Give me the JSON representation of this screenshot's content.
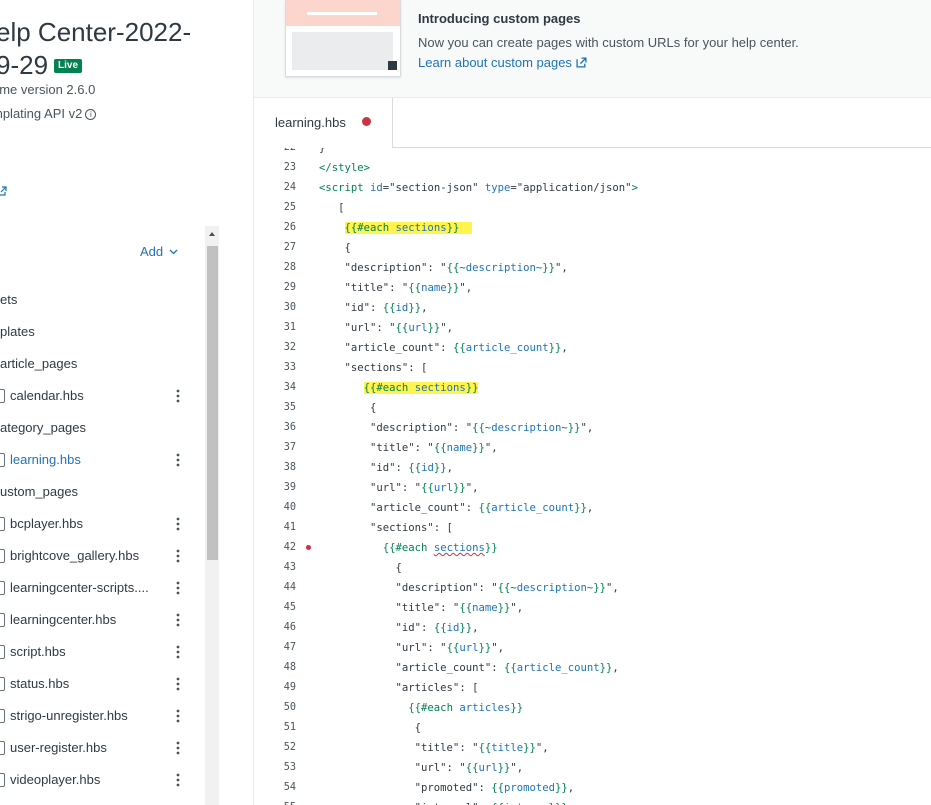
{
  "theme": {
    "title_line1": "elp Center-2022-",
    "title_line2": "9-29",
    "live_badge": "Live",
    "version": "eme version 2.6.0",
    "api": "mplating API v2",
    "info_icon": "i"
  },
  "files": {
    "add_label": "Add",
    "items": [
      {
        "label": "ets",
        "kind": "folder"
      },
      {
        "label": "plates",
        "kind": "folder"
      },
      {
        "label": "article_pages",
        "kind": "folder"
      },
      {
        "label": "calendar.hbs",
        "kind": "file"
      },
      {
        "label": "ategory_pages",
        "kind": "folder"
      },
      {
        "label": "learning.hbs",
        "kind": "file",
        "active": true
      },
      {
        "label": "ustom_pages",
        "kind": "folder"
      },
      {
        "label": "bcplayer.hbs",
        "kind": "file"
      },
      {
        "label": "brightcove_gallery.hbs",
        "kind": "file"
      },
      {
        "label": "learningcenter-scripts....",
        "kind": "file"
      },
      {
        "label": "learningcenter.hbs",
        "kind": "file"
      },
      {
        "label": "script.hbs",
        "kind": "file"
      },
      {
        "label": "status.hbs",
        "kind": "file"
      },
      {
        "label": "strigo-unregister.hbs",
        "kind": "file"
      },
      {
        "label": "user-register.hbs",
        "kind": "file"
      },
      {
        "label": "videoplayer.hbs",
        "kind": "file"
      }
    ]
  },
  "banner": {
    "title": "Introducing custom pages",
    "text": "Now you can create pages with custom URLs for your help center.",
    "link": "Learn about custom pages"
  },
  "tab": {
    "label": "learning.hbs"
  },
  "editor": {
    "lines": [
      {
        "n": "22",
        "segs": [
          {
            "t": "}",
            "c": "plain"
          }
        ]
      },
      {
        "n": "23",
        "segs": [
          {
            "t": "</style>",
            "c": "tag"
          }
        ]
      },
      {
        "n": "24",
        "segs": [
          {
            "t": "<script ",
            "c": "tag"
          },
          {
            "t": "id",
            "c": "attr"
          },
          {
            "t": "=\"section-json\" ",
            "c": "str"
          },
          {
            "t": "type",
            "c": "attr"
          },
          {
            "t": "=\"application/json\"",
            "c": "str"
          },
          {
            "t": ">",
            "c": "tag"
          }
        ]
      },
      {
        "n": "25",
        "segs": [
          {
            "t": "   [",
            "c": "plain"
          }
        ]
      },
      {
        "n": "26",
        "segs": [
          {
            "t": "    ",
            "c": "plain"
          },
          {
            "t": "{{#each ",
            "c": "hb",
            "hl": true
          },
          {
            "t": "sections",
            "c": "var",
            "hl": true
          },
          {
            "t": "}}  ",
            "c": "hb",
            "hl": true
          }
        ]
      },
      {
        "n": "27",
        "segs": [
          {
            "t": "    {",
            "c": "plain"
          }
        ]
      },
      {
        "n": "28",
        "segs": [
          {
            "t": "    \"description\": \"",
            "c": "plain"
          },
          {
            "t": "{{~",
            "c": "hb"
          },
          {
            "t": "description",
            "c": "var"
          },
          {
            "t": "~}}",
            "c": "hb"
          },
          {
            "t": "\",",
            "c": "plain"
          }
        ]
      },
      {
        "n": "29",
        "segs": [
          {
            "t": "    \"title\": \"",
            "c": "plain"
          },
          {
            "t": "{{",
            "c": "hb"
          },
          {
            "t": "name",
            "c": "var"
          },
          {
            "t": "}}",
            "c": "hb"
          },
          {
            "t": "\",",
            "c": "plain"
          }
        ]
      },
      {
        "n": "30",
        "segs": [
          {
            "t": "    \"id\": ",
            "c": "plain"
          },
          {
            "t": "{{",
            "c": "hb"
          },
          {
            "t": "id",
            "c": "var"
          },
          {
            "t": "}}",
            "c": "hb"
          },
          {
            "t": ",",
            "c": "plain"
          }
        ]
      },
      {
        "n": "31",
        "segs": [
          {
            "t": "    \"url\": \"",
            "c": "plain"
          },
          {
            "t": "{{",
            "c": "hb"
          },
          {
            "t": "url",
            "c": "var"
          },
          {
            "t": "}}",
            "c": "hb"
          },
          {
            "t": "\",",
            "c": "plain"
          }
        ]
      },
      {
        "n": "32",
        "segs": [
          {
            "t": "    \"article_count\": ",
            "c": "plain"
          },
          {
            "t": "{{",
            "c": "hb"
          },
          {
            "t": "article_count",
            "c": "var"
          },
          {
            "t": "}}",
            "c": "hb"
          },
          {
            "t": ",",
            "c": "plain"
          }
        ]
      },
      {
        "n": "33",
        "segs": [
          {
            "t": "    \"sections\": [",
            "c": "plain"
          }
        ]
      },
      {
        "n": "34",
        "segs": [
          {
            "t": "       ",
            "c": "plain"
          },
          {
            "t": "{{#each ",
            "c": "hb",
            "hl": true
          },
          {
            "t": "sections",
            "c": "var",
            "hl": true
          },
          {
            "t": "}}",
            "c": "hb",
            "hl": true
          }
        ]
      },
      {
        "n": "35",
        "segs": [
          {
            "t": "        {",
            "c": "plain"
          }
        ]
      },
      {
        "n": "36",
        "segs": [
          {
            "t": "        \"description\": \"",
            "c": "plain"
          },
          {
            "t": "{{~",
            "c": "hb"
          },
          {
            "t": "description",
            "c": "var"
          },
          {
            "t": "~}}",
            "c": "hb"
          },
          {
            "t": "\",",
            "c": "plain"
          }
        ]
      },
      {
        "n": "37",
        "segs": [
          {
            "t": "        \"title\": \"",
            "c": "plain"
          },
          {
            "t": "{{",
            "c": "hb"
          },
          {
            "t": "name",
            "c": "var"
          },
          {
            "t": "}}",
            "c": "hb"
          },
          {
            "t": "\",",
            "c": "plain"
          }
        ]
      },
      {
        "n": "38",
        "segs": [
          {
            "t": "        \"id\": ",
            "c": "plain"
          },
          {
            "t": "{{",
            "c": "hb"
          },
          {
            "t": "id",
            "c": "var"
          },
          {
            "t": "}}",
            "c": "hb"
          },
          {
            "t": ",",
            "c": "plain"
          }
        ]
      },
      {
        "n": "39",
        "segs": [
          {
            "t": "        \"url\": \"",
            "c": "plain"
          },
          {
            "t": "{{",
            "c": "hb"
          },
          {
            "t": "url",
            "c": "var"
          },
          {
            "t": "}}",
            "c": "hb"
          },
          {
            "t": "\",",
            "c": "plain"
          }
        ]
      },
      {
        "n": "40",
        "segs": [
          {
            "t": "        \"article_count\": ",
            "c": "plain"
          },
          {
            "t": "{{",
            "c": "hb"
          },
          {
            "t": "article_count",
            "c": "var"
          },
          {
            "t": "}}",
            "c": "hb"
          },
          {
            "t": ",",
            "c": "plain"
          }
        ]
      },
      {
        "n": "41",
        "segs": [
          {
            "t": "        \"sections\": [",
            "c": "plain"
          }
        ]
      },
      {
        "n": "42",
        "bp": true,
        "segs": [
          {
            "t": "          ",
            "c": "plain"
          },
          {
            "t": "{{#each ",
            "c": "hb"
          },
          {
            "t": "sections",
            "c": "var",
            "err": true
          },
          {
            "t": "}}",
            "c": "hb"
          }
        ]
      },
      {
        "n": "43",
        "segs": [
          {
            "t": "            {",
            "c": "plain"
          }
        ]
      },
      {
        "n": "44",
        "segs": [
          {
            "t": "            \"description\": \"",
            "c": "plain"
          },
          {
            "t": "{{~",
            "c": "hb"
          },
          {
            "t": "description",
            "c": "var"
          },
          {
            "t": "~}}",
            "c": "hb"
          },
          {
            "t": "\",",
            "c": "plain"
          }
        ]
      },
      {
        "n": "45",
        "segs": [
          {
            "t": "            \"title\": \"",
            "c": "plain"
          },
          {
            "t": "{{",
            "c": "hb"
          },
          {
            "t": "name",
            "c": "var"
          },
          {
            "t": "}}",
            "c": "hb"
          },
          {
            "t": "\",",
            "c": "plain"
          }
        ]
      },
      {
        "n": "46",
        "segs": [
          {
            "t": "            \"id\": ",
            "c": "plain"
          },
          {
            "t": "{{",
            "c": "hb"
          },
          {
            "t": "id",
            "c": "var"
          },
          {
            "t": "}}",
            "c": "hb"
          },
          {
            "t": ",",
            "c": "plain"
          }
        ]
      },
      {
        "n": "47",
        "segs": [
          {
            "t": "            \"url\": \"",
            "c": "plain"
          },
          {
            "t": "{{",
            "c": "hb"
          },
          {
            "t": "url",
            "c": "var"
          },
          {
            "t": "}}",
            "c": "hb"
          },
          {
            "t": "\",",
            "c": "plain"
          }
        ]
      },
      {
        "n": "48",
        "segs": [
          {
            "t": "            \"article_count\": ",
            "c": "plain"
          },
          {
            "t": "{{",
            "c": "hb"
          },
          {
            "t": "article_count",
            "c": "var"
          },
          {
            "t": "}}",
            "c": "hb"
          },
          {
            "t": ",",
            "c": "plain"
          }
        ]
      },
      {
        "n": "49",
        "segs": [
          {
            "t": "            \"articles\": [",
            "c": "plain"
          }
        ]
      },
      {
        "n": "50",
        "segs": [
          {
            "t": "              ",
            "c": "plain"
          },
          {
            "t": "{{#each ",
            "c": "hb"
          },
          {
            "t": "articles",
            "c": "var"
          },
          {
            "t": "}}",
            "c": "hb"
          }
        ]
      },
      {
        "n": "51",
        "segs": [
          {
            "t": "               {",
            "c": "plain"
          }
        ]
      },
      {
        "n": "52",
        "segs": [
          {
            "t": "               \"title\": \"",
            "c": "plain"
          },
          {
            "t": "{{",
            "c": "hb"
          },
          {
            "t": "title",
            "c": "var"
          },
          {
            "t": "}}",
            "c": "hb"
          },
          {
            "t": "\",",
            "c": "plain"
          }
        ]
      },
      {
        "n": "53",
        "segs": [
          {
            "t": "               \"url\": \"",
            "c": "plain"
          },
          {
            "t": "{{",
            "c": "hb"
          },
          {
            "t": "url",
            "c": "var"
          },
          {
            "t": "}}",
            "c": "hb"
          },
          {
            "t": "\",",
            "c": "plain"
          }
        ]
      },
      {
        "n": "54",
        "segs": [
          {
            "t": "               \"promoted\": ",
            "c": "plain"
          },
          {
            "t": "{{",
            "c": "hb"
          },
          {
            "t": "promoted",
            "c": "var"
          },
          {
            "t": "}}",
            "c": "hb"
          },
          {
            "t": ",",
            "c": "plain"
          }
        ]
      },
      {
        "n": "55",
        "segs": [
          {
            "t": "               \"internal\": ",
            "c": "plain"
          },
          {
            "t": "{{",
            "c": "hb"
          },
          {
            "t": "internal",
            "c": "var"
          },
          {
            "t": "}}",
            "c": "hb"
          }
        ]
      }
    ]
  }
}
